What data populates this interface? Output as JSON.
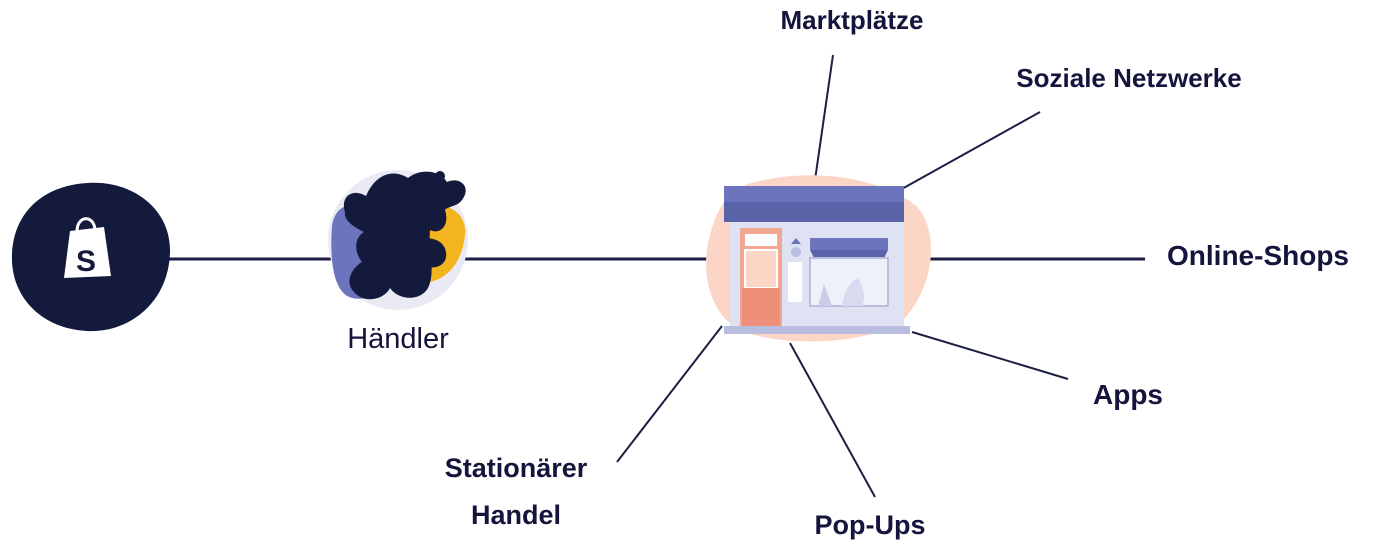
{
  "colors": {
    "ink": "#14143c",
    "navy": "#141a3c",
    "periwinkle": "#6b74bd",
    "yellow": "#f2b51f",
    "peach": "#fbd6c6",
    "salmon": "#ee8f7a",
    "store_wall": "#dfe2f2",
    "store_window": "#eef0fa",
    "white": "#ffffff"
  },
  "icons": {
    "platform": "shopify-bag-icon",
    "merchant": "merchant-avatar-illustration",
    "store": "storefront-illustration"
  },
  "labels": {
    "merchant": "Händler",
    "marketplaces": "Marktplätze",
    "social": "Soziale Netzwerke",
    "online_shops": "Online-Shops",
    "apps": "Apps",
    "pop_ups": "Pop-Ups",
    "retail_line1": "Stationärer",
    "retail_line2": "Handel"
  },
  "logo_text": "S"
}
